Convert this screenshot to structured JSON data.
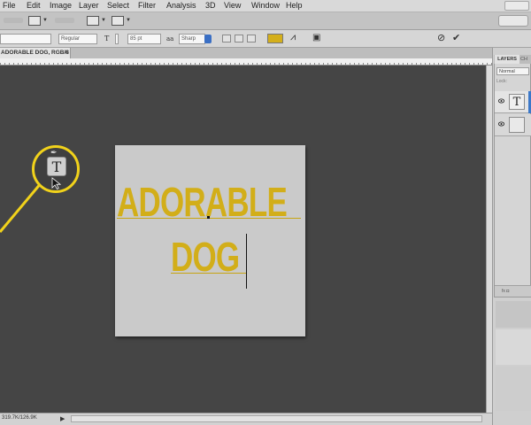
{
  "menubar": {
    "items": [
      "File",
      "Edit",
      "Image",
      "Layer",
      "Select",
      "Filter",
      "Analysis",
      "3D",
      "View",
      "Window",
      "Help"
    ]
  },
  "options_bar": {
    "font_style": "Regular",
    "font_size": "85 pt",
    "antialias": "Sharp",
    "text_color": "#d4af1b",
    "cancel_icon": "cancel-icon",
    "commit_icon": "checkmark-icon"
  },
  "document": {
    "tab_title": "ADORABLE DOG, RGB/8",
    "text_line_1": "ADORABLE",
    "text_line_2": "DOG",
    "text_color": "#d2ae19"
  },
  "status": {
    "doc_size": "319.7K/126.9K"
  },
  "layers_panel": {
    "tab_label": "LAYERS",
    "tab_label_2": "CH",
    "blend_mode": "Normal",
    "lock_label": "Lock:",
    "footer_icons": "fx  ◘"
  },
  "tools": {
    "type_tool_glyph": "T",
    "pen_glyph": "✒",
    "layer_type_glyph": "T"
  },
  "colors": {
    "accent": "#f1d21b",
    "selection": "#3b78c9",
    "pasteboard": "#454545"
  }
}
